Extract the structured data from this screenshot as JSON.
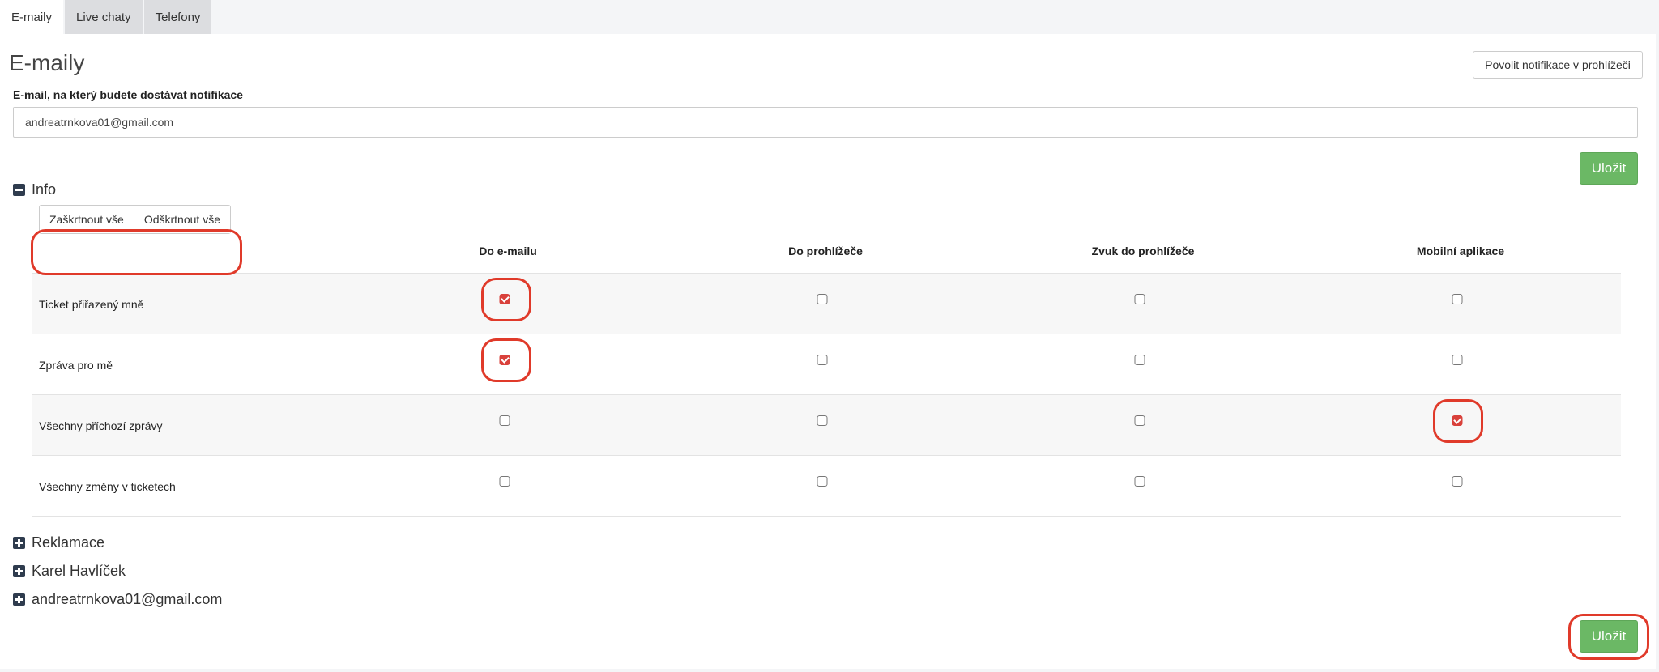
{
  "tabs": [
    {
      "label": "E-maily",
      "active": true
    },
    {
      "label": "Live chaty",
      "active": false
    },
    {
      "label": "Telefony",
      "active": false
    }
  ],
  "page": {
    "title": "E-maily",
    "browser_notifications_button": "Povolit notifikace v prohlížeči",
    "email_label": "E-mail, na který budete dostávat notifikace",
    "email_value": "andreatrnkova01@gmail.com",
    "save_label": "Uložit"
  },
  "info_section": {
    "title": "Info",
    "expanded": true,
    "check_all": "Zaškrtnout vše",
    "uncheck_all": "Odškrtnout vše",
    "columns": [
      "Do e-mailu",
      "Do prohlížeče",
      "Zvuk do prohlížeče",
      "Mobilní aplikace"
    ],
    "rows": [
      {
        "label": "Ticket přiřazený mně",
        "checks": [
          true,
          false,
          false,
          false
        ]
      },
      {
        "label": "Zpráva pro mě",
        "checks": [
          true,
          false,
          false,
          false
        ]
      },
      {
        "label": "Všechny příchozí zprávy",
        "checks": [
          false,
          false,
          false,
          true
        ]
      },
      {
        "label": "Všechny změny v ticketech",
        "checks": [
          false,
          false,
          false,
          false
        ]
      }
    ]
  },
  "collapsed_sections": [
    {
      "title": "Reklamace"
    },
    {
      "title": "Karel Havlíček"
    },
    {
      "title": "andreatrnkova01@gmail.com"
    }
  ],
  "colors": {
    "accent_green": "#6bb865",
    "checkbox_checked": "#d9413b",
    "highlight_ring": "#e03a2a"
  }
}
